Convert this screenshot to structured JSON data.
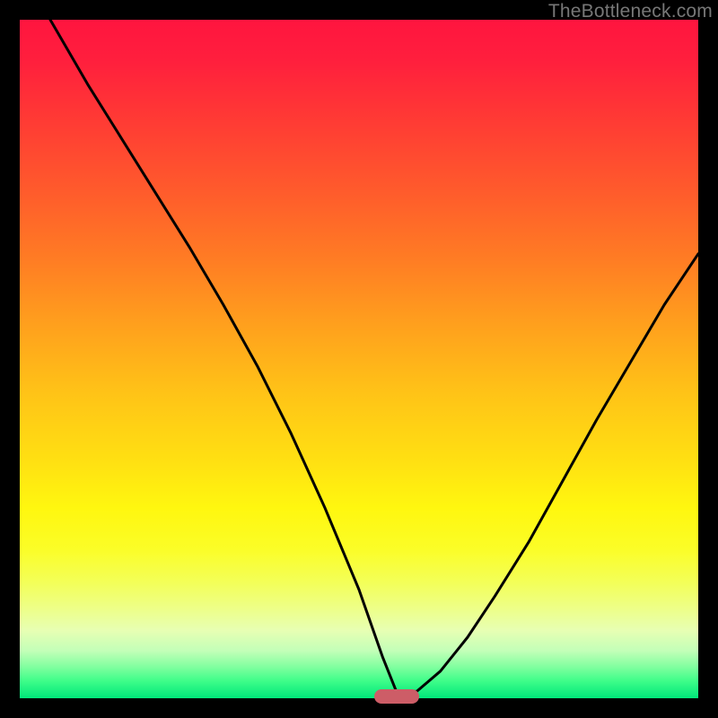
{
  "watermark": "TheBottleneck.com",
  "colors": {
    "frame": "#000000",
    "gradient_stops": [
      {
        "offset": 0.0,
        "color": "#ff153f"
      },
      {
        "offset": 0.06,
        "color": "#ff1f3d"
      },
      {
        "offset": 0.15,
        "color": "#ff3b34"
      },
      {
        "offset": 0.25,
        "color": "#ff5a2c"
      },
      {
        "offset": 0.35,
        "color": "#ff7b24"
      },
      {
        "offset": 0.45,
        "color": "#ffa01d"
      },
      {
        "offset": 0.55,
        "color": "#ffc317"
      },
      {
        "offset": 0.65,
        "color": "#ffe012"
      },
      {
        "offset": 0.72,
        "color": "#fff70f"
      },
      {
        "offset": 0.78,
        "color": "#fbfd27"
      },
      {
        "offset": 0.83,
        "color": "#f3ff59"
      },
      {
        "offset": 0.87,
        "color": "#edff8b"
      },
      {
        "offset": 0.9,
        "color": "#e7ffb3"
      },
      {
        "offset": 0.93,
        "color": "#c3ffb8"
      },
      {
        "offset": 0.955,
        "color": "#7dff9e"
      },
      {
        "offset": 0.975,
        "color": "#3dfd89"
      },
      {
        "offset": 1.0,
        "color": "#00e67a"
      }
    ],
    "curve": "#000000",
    "marker": "#cd5d67"
  },
  "marker": {
    "x_frac": 0.555,
    "width_frac": 0.066,
    "comment": "red pill marker sitting on the x-axis at the curve minimum"
  },
  "chart_data": {
    "type": "line",
    "title": "",
    "xlabel": "",
    "ylabel": "",
    "xlim": [
      0,
      1
    ],
    "ylim": [
      0,
      1
    ],
    "series": [
      {
        "name": "bottleneck-curve",
        "comment": "Approximate V-shaped curve; x and y are fractions of the plot area (0,0 = top-left).",
        "x": [
          0.045,
          0.1,
          0.15,
          0.2,
          0.25,
          0.3,
          0.35,
          0.4,
          0.45,
          0.5,
          0.535,
          0.555,
          0.585,
          0.62,
          0.66,
          0.7,
          0.75,
          0.8,
          0.85,
          0.9,
          0.95,
          1.0
        ],
        "y": [
          0.0,
          0.095,
          0.175,
          0.255,
          0.335,
          0.42,
          0.51,
          0.61,
          0.72,
          0.84,
          0.94,
          0.99,
          0.99,
          0.96,
          0.91,
          0.85,
          0.77,
          0.68,
          0.59,
          0.505,
          0.42,
          0.345
        ]
      }
    ]
  }
}
